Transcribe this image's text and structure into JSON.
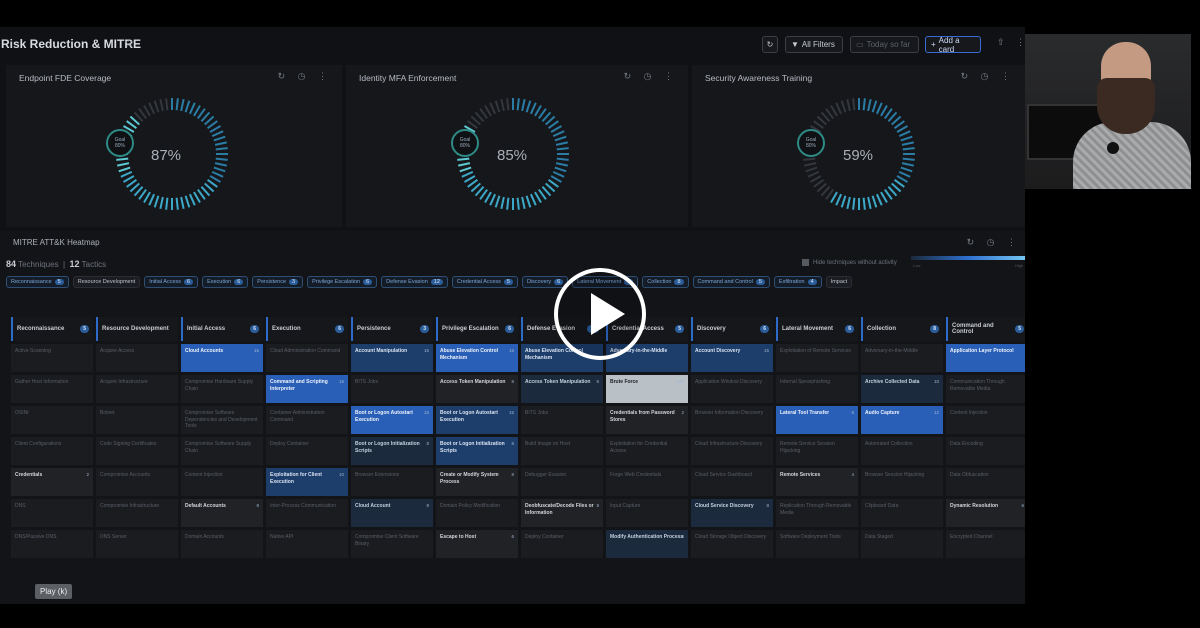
{
  "header": {
    "title": "Risk Reduction & MITRE",
    "all_filters": "All Filters",
    "time_range": "Today so far",
    "add_card": "Add a card"
  },
  "panels": [
    {
      "title": "Endpoint FDE Coverage",
      "goal_label": "Goal",
      "goal": "80%",
      "value": "87%",
      "fraction": 0.87
    },
    {
      "title": "Identity MFA Enforcement",
      "goal_label": "Goal",
      "goal": "80%",
      "value": "85%",
      "fraction": 0.85
    },
    {
      "title": "Security Awareness Training",
      "goal_label": "Goal",
      "goal": "80%",
      "value": "59%",
      "fraction": 0.59
    }
  ],
  "heatmap": {
    "title": "MITRE ATT&K Heatmap",
    "techniques_count": "84",
    "techniques_label": "Techniques",
    "tactics_count": "12",
    "tactics_label": "Tactics",
    "hide_label": "Hide techniques without activity",
    "scale_low": "Low",
    "scale_high": "High",
    "chips": [
      {
        "label": "Reconnaissance",
        "count": "5"
      },
      {
        "label": "Resource Development",
        "count": ""
      },
      {
        "label": "Initial Access",
        "count": "6"
      },
      {
        "label": "Execution",
        "count": "6"
      },
      {
        "label": "Persistence",
        "count": "3"
      },
      {
        "label": "Privilege Escalation",
        "count": "6"
      },
      {
        "label": "Defense Evasion",
        "count": "12"
      },
      {
        "label": "Credential Access",
        "count": "5"
      },
      {
        "label": "Discovery",
        "count": "6"
      },
      {
        "label": "Lateral Movement",
        "count": "6"
      },
      {
        "label": "Collection",
        "count": "8"
      },
      {
        "label": "Command and Control",
        "count": "5"
      },
      {
        "label": "Exfiltration",
        "count": "4"
      },
      {
        "label": "Impact",
        "count": ""
      }
    ],
    "columns": [
      {
        "label": "Reconnaissance",
        "count": "5"
      },
      {
        "label": "Resource Development",
        "count": ""
      },
      {
        "label": "Initial Access",
        "count": "6"
      },
      {
        "label": "Execution",
        "count": "6"
      },
      {
        "label": "Persistence",
        "count": "3"
      },
      {
        "label": "Privilege Escalation",
        "count": "6"
      },
      {
        "label": "Defense Evasion",
        "count": "12"
      },
      {
        "label": "Credential Access",
        "count": "5"
      },
      {
        "label": "Discovery",
        "count": "6"
      },
      {
        "label": "Lateral Movement",
        "count": "6"
      },
      {
        "label": "Collection",
        "count": "8"
      },
      {
        "label": "Command and Control",
        "count": "5"
      }
    ],
    "rows": [
      [
        [
          "Active Scanning",
          "",
          ""
        ],
        [
          "Acquire Access",
          "",
          ""
        ],
        [
          "Cloud Accounts",
          "l3",
          "15"
        ],
        [
          "Cloud Administration Command",
          "",
          ""
        ],
        [
          "Account Manipulation",
          "l2",
          "15"
        ],
        [
          "Abuse Elevation Control Mechanism",
          "l3",
          "15"
        ],
        [
          "Abuse Elevation Control Mechanism",
          "l2",
          ""
        ],
        [
          "Adversary-in-the-Middle",
          "l2",
          ""
        ],
        [
          "Account Discovery",
          "l2",
          "15"
        ],
        [
          "Exploitation of Remote Services",
          "",
          ""
        ],
        [
          "Adversary-in-the-Middle",
          "",
          ""
        ],
        [
          "Application Layer Protocol",
          "l3",
          ""
        ]
      ],
      [
        [
          "Gather Host Information",
          "",
          ""
        ],
        [
          "Acquire Infrastructure",
          "",
          ""
        ],
        [
          "Compromise Hardware Supply Chain",
          "",
          ""
        ],
        [
          "Command and Scripting Interpreter",
          "l3",
          "15"
        ],
        [
          "BITS Jobs",
          "",
          ""
        ],
        [
          "Access Token Manipulation",
          "dk",
          "8"
        ],
        [
          "Access Token Manipulation",
          "l1",
          "8"
        ],
        [
          "Brute Force",
          "l4",
          "100"
        ],
        [
          "Application Window Discovery",
          "",
          ""
        ],
        [
          "Internal Spearphishing",
          "",
          ""
        ],
        [
          "Archive Collected Data",
          "l1",
          "10"
        ],
        [
          "Communication Through Removable Media",
          "",
          ""
        ]
      ],
      [
        [
          "OSINt",
          "",
          ""
        ],
        [
          "Botnet",
          "",
          ""
        ],
        [
          "Compromise Software Dependencies and Development Tools",
          "",
          ""
        ],
        [
          "Container Administration Command",
          "",
          ""
        ],
        [
          "Boot or Logon Autostart Execution",
          "l3",
          "15"
        ],
        [
          "Boot or Logon Autostart Execution",
          "l2",
          "15"
        ],
        [
          "BITS Jobs",
          "",
          ""
        ],
        [
          "Credentials from Password Stores",
          "dk",
          "2"
        ],
        [
          "Browser Information Discovery",
          "",
          ""
        ],
        [
          "Lateral Tool Transfer",
          "l3",
          "8"
        ],
        [
          "Audio Capture",
          "l3",
          "12"
        ],
        [
          "Content Injection",
          "",
          ""
        ]
      ],
      [
        [
          "Client Configurations",
          "",
          ""
        ],
        [
          "Code Signing Certificates",
          "",
          ""
        ],
        [
          "Compromise Software Supply Chain",
          "",
          ""
        ],
        [
          "Deploy Container",
          "",
          ""
        ],
        [
          "Boot or Logon Initialization Scripts",
          "l1",
          "8"
        ],
        [
          "Boot or Logon Initialization Scripts",
          "l2",
          "8"
        ],
        [
          "Build Image on Host",
          "",
          ""
        ],
        [
          "Exploitation for Credential Access",
          "",
          ""
        ],
        [
          "Cloud Infrastructure Discovery",
          "",
          ""
        ],
        [
          "Remote Service Session Hijacking",
          "",
          ""
        ],
        [
          "Automated Collection",
          "",
          ""
        ],
        [
          "Data Encoding",
          "",
          ""
        ]
      ],
      [
        [
          "Credentials",
          "dk",
          "2"
        ],
        [
          "Compromise Accounts",
          "",
          ""
        ],
        [
          "Content Injection",
          "",
          ""
        ],
        [
          "Exploitation for Client Execution",
          "l2",
          "10"
        ],
        [
          "Browser Extensions",
          "",
          ""
        ],
        [
          "Create or Modify System Process",
          "dk",
          "8"
        ],
        [
          "Debugger Evasion",
          "",
          ""
        ],
        [
          "Forge Web Credentials",
          "",
          ""
        ],
        [
          "Cloud Service Dashboard",
          "",
          ""
        ],
        [
          "Remote Services",
          "dk",
          "4"
        ],
        [
          "Browser Session Hijacking",
          "",
          ""
        ],
        [
          "Data Obfuscation",
          "",
          ""
        ]
      ],
      [
        [
          "DNS",
          "",
          ""
        ],
        [
          "Compromise Infrastructure",
          "",
          ""
        ],
        [
          "Default Accounts",
          "dk",
          "8"
        ],
        [
          "Inter-Process Communication",
          "",
          ""
        ],
        [
          "Cloud Account",
          "l1",
          "8"
        ],
        [
          "Domain Policy Modification",
          "",
          ""
        ],
        [
          "Deobfuscate/Decode Files or Information",
          "dk",
          "8"
        ],
        [
          "Input Capture",
          "",
          ""
        ],
        [
          "Cloud Service Discovery",
          "l1",
          "8"
        ],
        [
          "Replication Through Removable Media",
          "",
          ""
        ],
        [
          "Clipboard Data",
          "",
          ""
        ],
        [
          "Dynamic Resolution",
          "dk",
          "6"
        ]
      ],
      [
        [
          "DNS/Passive DNS",
          "",
          ""
        ],
        [
          "DNS Server",
          "",
          ""
        ],
        [
          "Domain Accounts",
          "",
          ""
        ],
        [
          "Native API",
          "",
          ""
        ],
        [
          "Compromise Client Software Binary",
          "",
          ""
        ],
        [
          "Escape to Host",
          "dk",
          "6"
        ],
        [
          "Deploy Container",
          "",
          ""
        ],
        [
          "Modify Authentication Process",
          "l1",
          "8"
        ],
        [
          "Cloud Storage Object Discovery",
          "",
          ""
        ],
        [
          "Software Deployment Tools",
          "",
          ""
        ],
        [
          "Data Staged",
          "",
          ""
        ],
        [
          "Encrypted Channel",
          "",
          ""
        ]
      ]
    ]
  },
  "player": {
    "tooltip": "Play (k)"
  }
}
